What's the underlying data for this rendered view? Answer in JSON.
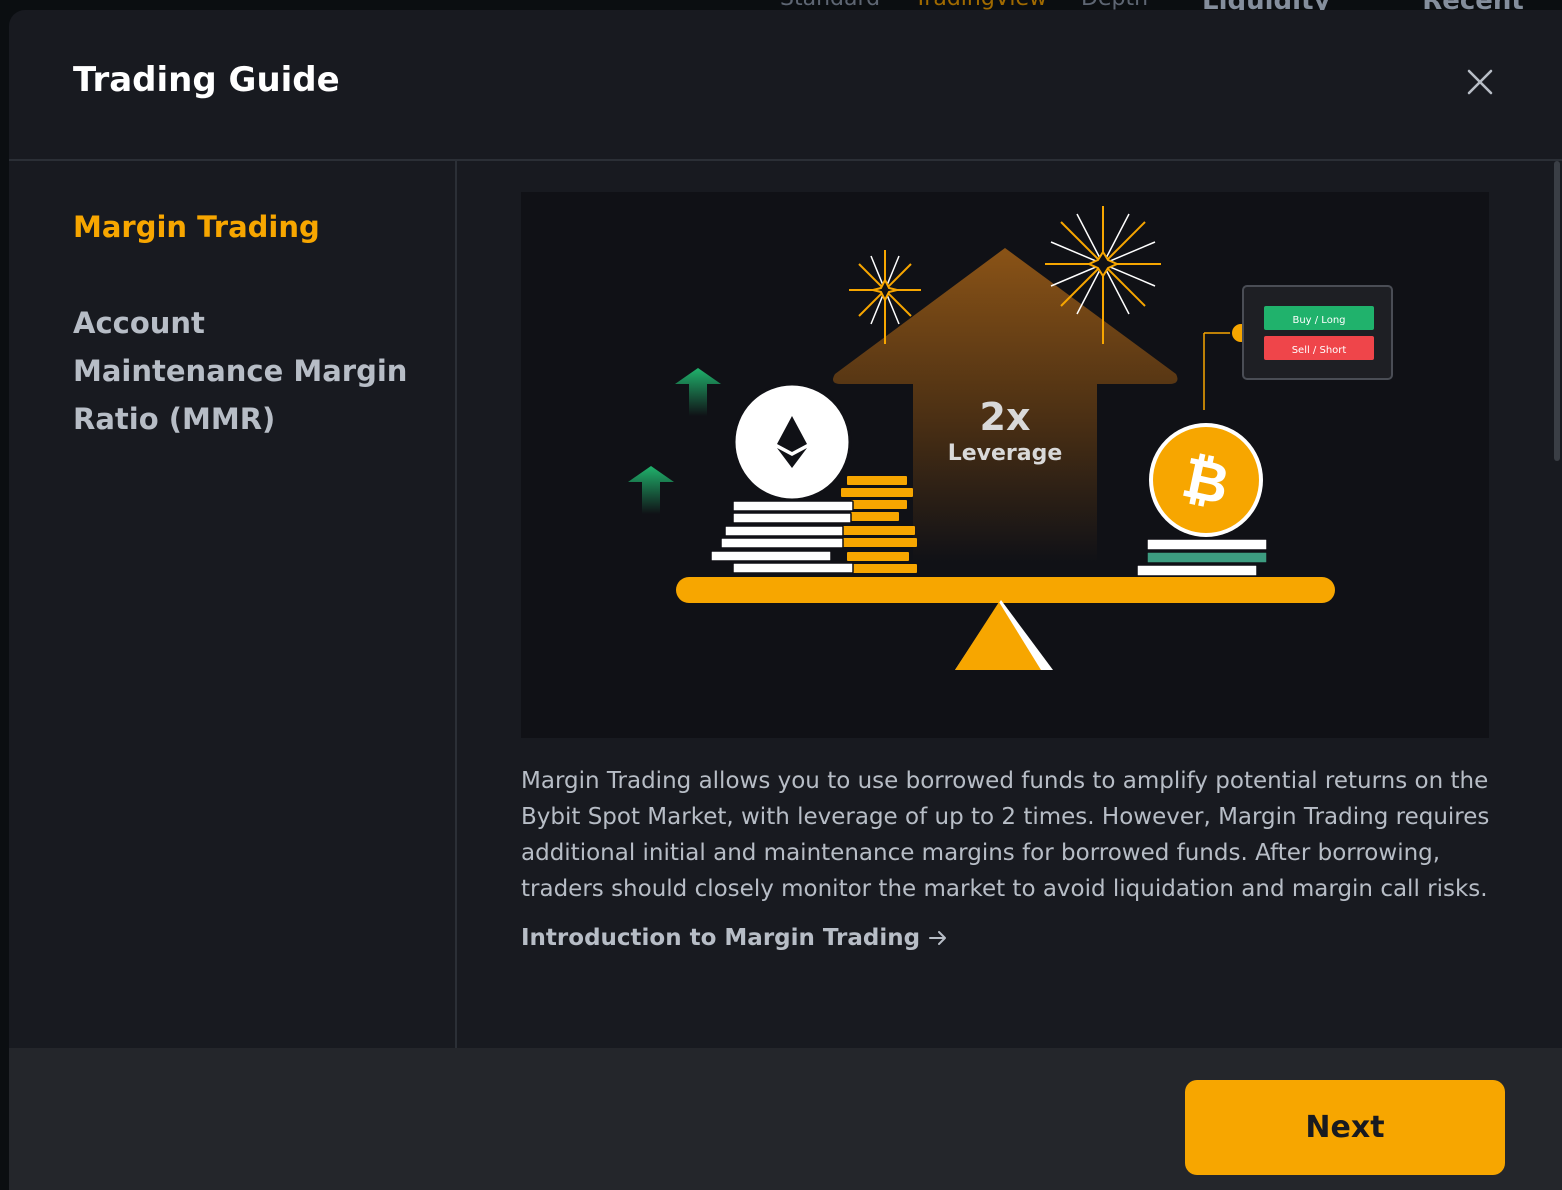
{
  "background_tabs": [
    "Standard",
    "TradingView",
    "Depth",
    "Liquidity View",
    "Recent Tra"
  ],
  "modal": {
    "title": "Trading Guide",
    "close_icon": "close-icon"
  },
  "sidebar": {
    "items": [
      {
        "label": "Margin Trading",
        "active": true
      },
      {
        "label": "Account Maintenance Margin Ratio (MMR)",
        "active": false
      }
    ]
  },
  "hero": {
    "leverage_value": "2x",
    "leverage_label": "Leverage",
    "buy_label": "Buy / Long",
    "sell_label": "Sell / Short",
    "accent_color": "#f7a600",
    "buy_color": "#20b26c",
    "sell_color": "#ef454a"
  },
  "content": {
    "description": "Margin Trading allows you to use borrowed funds to amplify potential returns on the Bybit Spot Market, with leverage of up to 2 times. However, Margin Trading requires additional initial and maintenance margins for borrowed funds. After borrowing, traders should closely monitor the market to avoid liquidation and margin call risks.",
    "link_label": "Introduction to Margin Trading",
    "link_icon": "arrow-right-icon"
  },
  "footer": {
    "next_label": "Next"
  }
}
